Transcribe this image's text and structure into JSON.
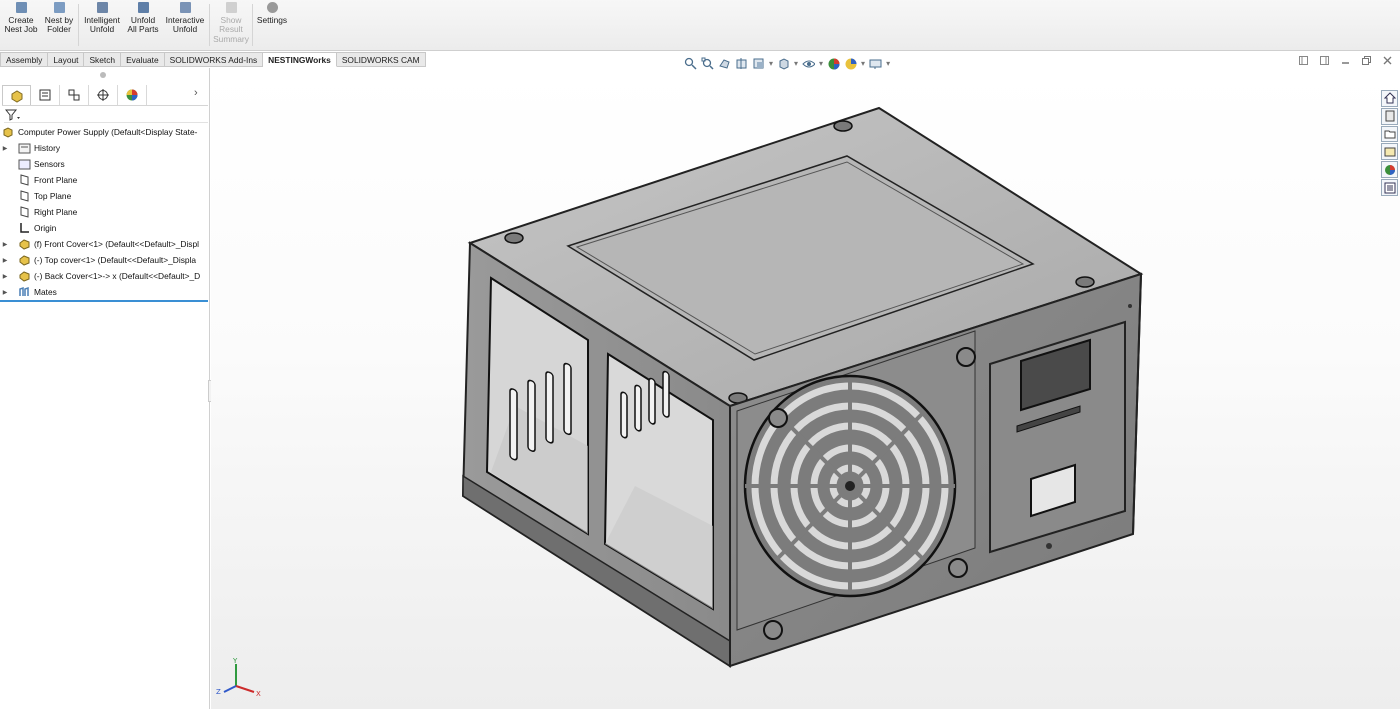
{
  "ribbon": {
    "buttons": [
      {
        "label_l1": "Create",
        "label_l2": "Nest Job",
        "icon": "create-nest-job-icon"
      },
      {
        "label_l1": "Nest by",
        "label_l2": "Folder",
        "icon": "nest-folder-icon"
      },
      {
        "label_l1": "Intelligent",
        "label_l2": "Unfold",
        "icon": "intelligent-unfold-icon"
      },
      {
        "label_l1": "Unfold",
        "label_l2": "All Parts",
        "icon": "unfold-all-icon"
      },
      {
        "label_l1": "Interactive",
        "label_l2": "Unfold",
        "icon": "interactive-unfold-icon"
      },
      {
        "label_l1": "Show",
        "label_l2": "Result",
        "label_l3": "Summary",
        "icon": "result-summary-icon"
      },
      {
        "label_l1": "Settings",
        "icon": "gear-icon"
      }
    ]
  },
  "tabs": [
    "Assembly",
    "Layout",
    "Sketch",
    "Evaluate",
    "SOLIDWORKS Add-Ins",
    "NESTINGWorks",
    "SOLIDWORKS CAM"
  ],
  "active_tab": "NESTINGWorks",
  "tree": {
    "root": "Computer Power Supply  (Default<Display State-",
    "items": [
      {
        "label": "History",
        "icon": "history-icon",
        "expandable": true
      },
      {
        "label": "Sensors",
        "icon": "sensors-icon",
        "expandable": false
      },
      {
        "label": "Front Plane",
        "icon": "plane-icon",
        "expandable": false
      },
      {
        "label": "Top Plane",
        "icon": "plane-icon",
        "expandable": false
      },
      {
        "label": "Right Plane",
        "icon": "plane-icon",
        "expandable": false
      },
      {
        "label": "Origin",
        "icon": "origin-icon",
        "expandable": false
      },
      {
        "label": "(f) Front Cover<1> (Default<<Default>_Displ",
        "icon": "part-icon",
        "expandable": true
      },
      {
        "label": "(-) Top cover<1> (Default<<Default>_Displa",
        "icon": "part-icon",
        "expandable": true
      },
      {
        "label": "(-) Back Cover<1>-> x (Default<<Default>_D",
        "icon": "part-icon",
        "expandable": true
      },
      {
        "label": "Mates",
        "icon": "mates-icon",
        "expandable": true
      }
    ]
  },
  "colors": {
    "accent": "#3a8fd4",
    "part": "#8a8a8a"
  }
}
